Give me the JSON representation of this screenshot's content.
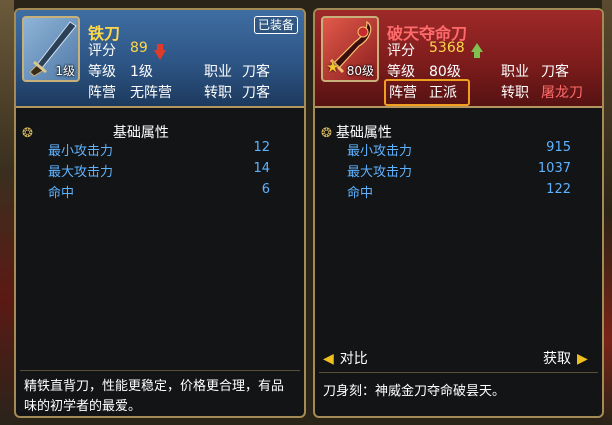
{
  "left_card": {
    "name": "铁刀",
    "equipped_badge": "已装备",
    "level_tag": "1级",
    "score_label": "评分",
    "score_value": "89",
    "level_label": "等级",
    "level_value": "1级",
    "class_label": "职业",
    "class_value": "刀客",
    "faction_label": "阵营",
    "faction_value": "无阵营",
    "job_label": "转职",
    "job_value": "刀客",
    "section_title": "基础属性",
    "attrs": [
      {
        "label": "最小攻击力",
        "value": "12"
      },
      {
        "label": "最大攻击力",
        "value": "14"
      },
      {
        "label": "命中",
        "value": "6"
      }
    ],
    "description": "精铁直背刀，性能更稳定，价格更合理，有品味的初学者的最爱。"
  },
  "right_card": {
    "name": "破天夺命刀",
    "level_tag": "80级",
    "score_label": "评分",
    "score_value": "5368",
    "level_label": "等级",
    "level_value": "80级",
    "class_label": "职业",
    "class_value": "刀客",
    "faction_label": "阵营",
    "faction_value": "正派",
    "job_label": "转职",
    "job_value": "屠龙刀",
    "section_title": "基础属性",
    "attrs": [
      {
        "label": "最小攻击力",
        "value": "915"
      },
      {
        "label": "最大攻击力",
        "value": "1037"
      },
      {
        "label": "命中",
        "value": "122"
      }
    ],
    "compare_label": "对比",
    "acquire_label": "获取",
    "description": "刀身刻：神威金刀夺命破昙天。"
  },
  "colors": {
    "left_header": "#2d5585",
    "right_header": "#7e1c1c",
    "attr_blue": "#5fb2ff",
    "name_gold": "#ffd84a",
    "name_red": "#ff6b6b",
    "highlight_orange": "#f0a020"
  },
  "icons": {
    "score_down": "red-down-arrow-icon",
    "score_up": "green-up-arrow-icon",
    "rarity": "star-icon",
    "section": "swirl-ornament-icon"
  }
}
